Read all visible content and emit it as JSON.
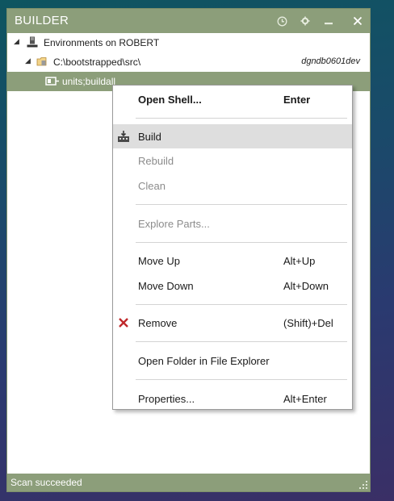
{
  "window": {
    "title": "BUILDER",
    "buttons": [
      "history-icon",
      "settings-icon",
      "minimize-icon",
      "close-icon"
    ]
  },
  "tree": {
    "root": {
      "label": "Environments on ROBERT"
    },
    "folder": {
      "label": "C:\\bootstrapped\\src\\",
      "env": "dgndb0601dev"
    },
    "leaf": {
      "label": "units;buildall"
    }
  },
  "menu": {
    "items": [
      {
        "label": "Open Shell...",
        "shortcut": "Enter"
      },
      {
        "label": "Build",
        "shortcut": ""
      },
      {
        "label": "Rebuild",
        "shortcut": ""
      },
      {
        "label": "Clean",
        "shortcut": ""
      },
      {
        "label": "Explore Parts...",
        "shortcut": ""
      },
      {
        "label": "Move Up",
        "shortcut": "Alt+Up"
      },
      {
        "label": "Move Down",
        "shortcut": "Alt+Down"
      },
      {
        "label": "Remove",
        "shortcut": "(Shift)+Del"
      },
      {
        "label": "Open Folder in File Explorer",
        "shortcut": ""
      },
      {
        "label": "Properties...",
        "shortcut": "Alt+Enter"
      }
    ]
  },
  "status": {
    "text": "Scan succeeded"
  },
  "colors": {
    "accent": "#8c9e7a",
    "remove": "#c0282a"
  }
}
